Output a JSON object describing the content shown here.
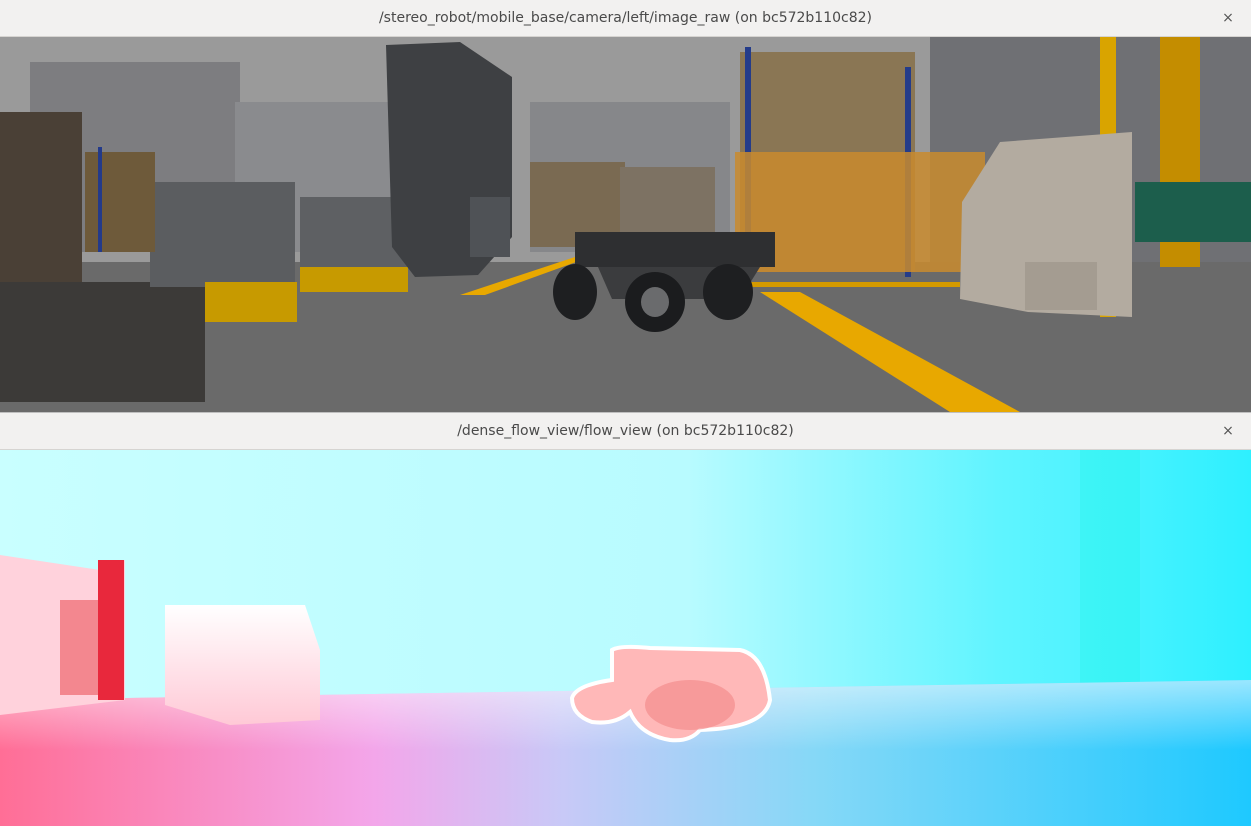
{
  "windows": [
    {
      "title": "/stereo_robot/mobile_base/camera/left/image_raw (on bc572b110c82)",
      "close_glyph": "×",
      "content": "warehouse-camera-image"
    },
    {
      "title": "/dense_flow_view/flow_view (on bc572b110c82)",
      "close_glyph": "×",
      "content": "dense-optical-flow-visualization"
    }
  ],
  "colors": {
    "titlebar": "#f2f1f0",
    "floor_line_yellow": "#e8a800",
    "flow_cyan": "#2ff3ff",
    "flow_red": "#e8283c"
  }
}
